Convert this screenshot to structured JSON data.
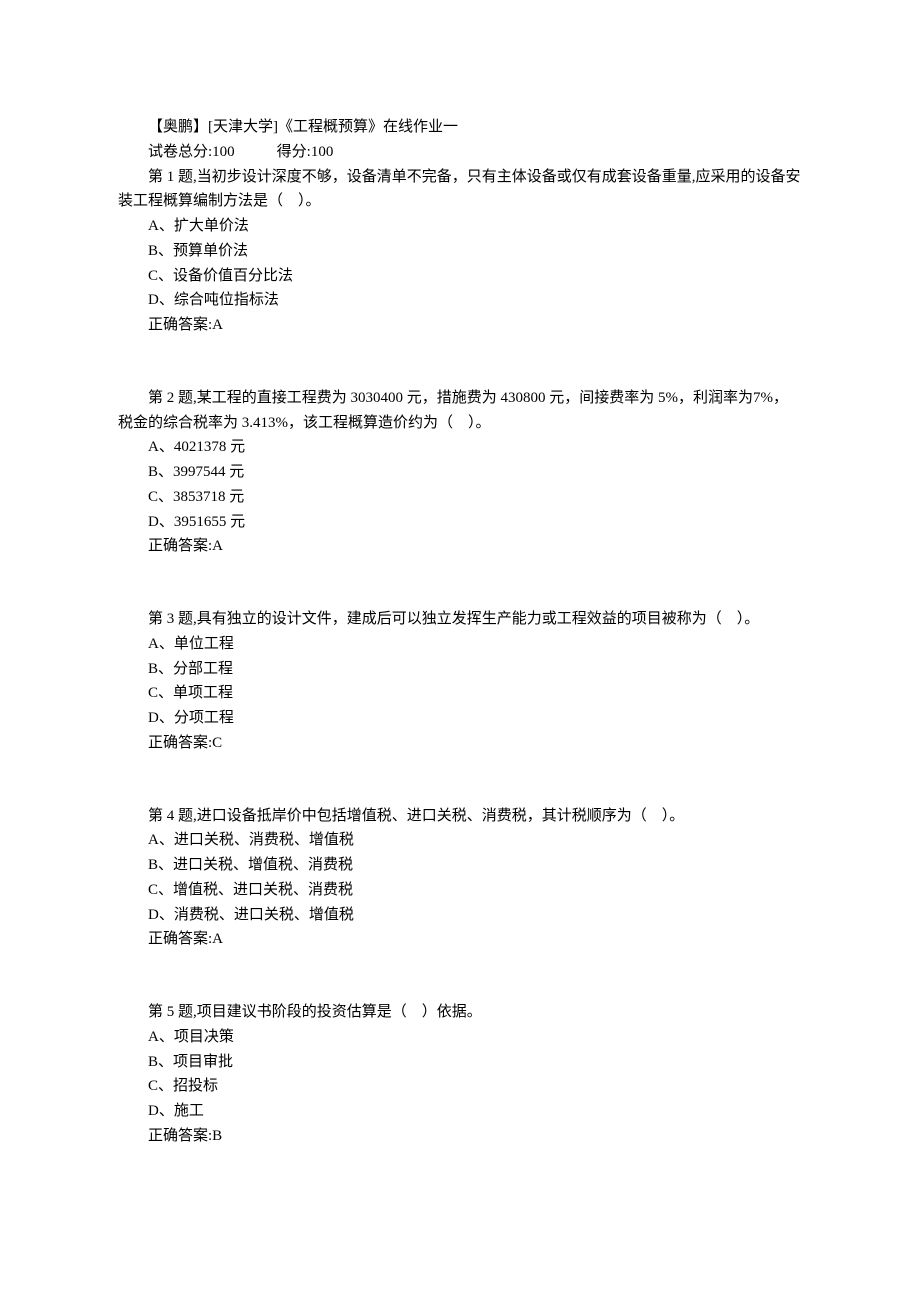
{
  "header": {
    "title": "【奥鹏】[天津大学]《工程概预算》在线作业一",
    "score_total_label": "试卷总分:100",
    "score_got_label": "得分:100"
  },
  "questions": [
    {
      "stem": "第 1 题,当初步设计深度不够，设备清单不完备，只有主体设备或仅有成套设备重量,应采用的设备安装工程概算编制方法是（　）。",
      "options": [
        "A、扩大单价法",
        "B、预算单价法",
        "C、设备价值百分比法",
        "D、综合吨位指标法"
      ],
      "answer": "正确答案:A"
    },
    {
      "stem": "第 2 题,某工程的直接工程费为 3030400 元，措施费为 430800 元，间接费率为 5%，利润率为7%，税金的综合税率为 3.413%，该工程概算造价约为（　）。",
      "options": [
        "A、4021378 元",
        "B、3997544 元",
        "C、3853718 元",
        "D、3951655 元"
      ],
      "answer": "正确答案:A"
    },
    {
      "stem": "第 3 题,具有独立的设计文件，建成后可以独立发挥生产能力或工程效益的项目被称为（　）。",
      "options": [
        "A、单位工程",
        "B、分部工程",
        "C、单项工程",
        "D、分项工程"
      ],
      "answer": "正确答案:C"
    },
    {
      "stem": "第 4 题,进口设备抵岸价中包括增值税、进口关税、消费税，其计税顺序为（　）。",
      "options": [
        "A、进口关税、消费税、增值税",
        "B、进口关税、增值税、消费税",
        "C、增值税、进口关税、消费税",
        "D、消费税、进口关税、增值税"
      ],
      "answer": "正确答案:A"
    },
    {
      "stem": "第 5 题,项目建议书阶段的投资估算是（　）依据。",
      "options": [
        "A、项目决策",
        "B、项目审批",
        "C、招投标",
        "D、施工"
      ],
      "answer": "正确答案:B"
    }
  ]
}
